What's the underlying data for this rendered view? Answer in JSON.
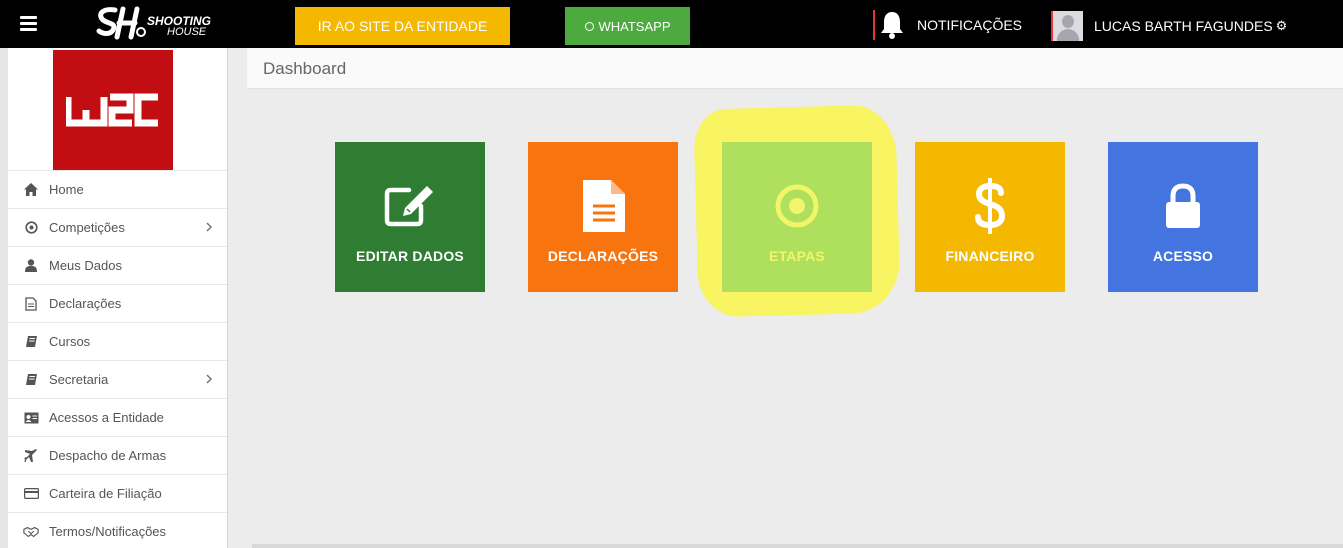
{
  "topbar": {
    "brand_line1": "SHOOTING",
    "brand_line2": "HOUSE",
    "site_button": "IR AO SITE DA ENTIDADE",
    "whatsapp_button": "WHATSAPP",
    "notifications_label": "NOTIFICAÇÕES",
    "user_name": "LUCAS BARTH FAGUNDES"
  },
  "sidebar": {
    "entity_logo_text": "W2C",
    "items": [
      {
        "label": "Home",
        "icon": "home-icon",
        "has_submenu": false
      },
      {
        "label": "Competições",
        "icon": "target-icon",
        "has_submenu": true
      },
      {
        "label": "Meus Dados",
        "icon": "user-icon",
        "has_submenu": false
      },
      {
        "label": "Declarações",
        "icon": "file-icon",
        "has_submenu": false
      },
      {
        "label": "Cursos",
        "icon": "book-icon",
        "has_submenu": false
      },
      {
        "label": "Secretaria",
        "icon": "book-icon",
        "has_submenu": true
      },
      {
        "label": "Acessos a Entidade",
        "icon": "id-card-icon",
        "has_submenu": false
      },
      {
        "label": "Despacho de Armas",
        "icon": "plane-icon",
        "has_submenu": false
      },
      {
        "label": "Carteira de Filiação",
        "icon": "credit-card-icon",
        "has_submenu": false
      },
      {
        "label": "Termos/Notificações",
        "icon": "handshake-icon",
        "has_submenu": false
      }
    ]
  },
  "main": {
    "page_title": "Dashboard",
    "tiles": [
      {
        "label": "EDITAR DADOS",
        "icon": "edit-icon",
        "color": "#2e7d32"
      },
      {
        "label": "DECLARAÇÕES",
        "icon": "document-icon",
        "color": "#f7740f"
      },
      {
        "label": "ETAPAS",
        "icon": "target-icon",
        "color": "#afe05d",
        "highlighted": true
      },
      {
        "label": "FINANCEIRO",
        "icon": "dollar-icon",
        "color": "#f5b800"
      },
      {
        "label": "ACESSO",
        "icon": "lock-icon",
        "color": "#4374e0"
      }
    ]
  },
  "colors": {
    "topbar": "#000000",
    "site_button": "#f5b800",
    "whatsapp_button": "#4daa3f",
    "entity_logo": "#c20e12",
    "highlight": "#f8f462",
    "background": "#ececec"
  }
}
